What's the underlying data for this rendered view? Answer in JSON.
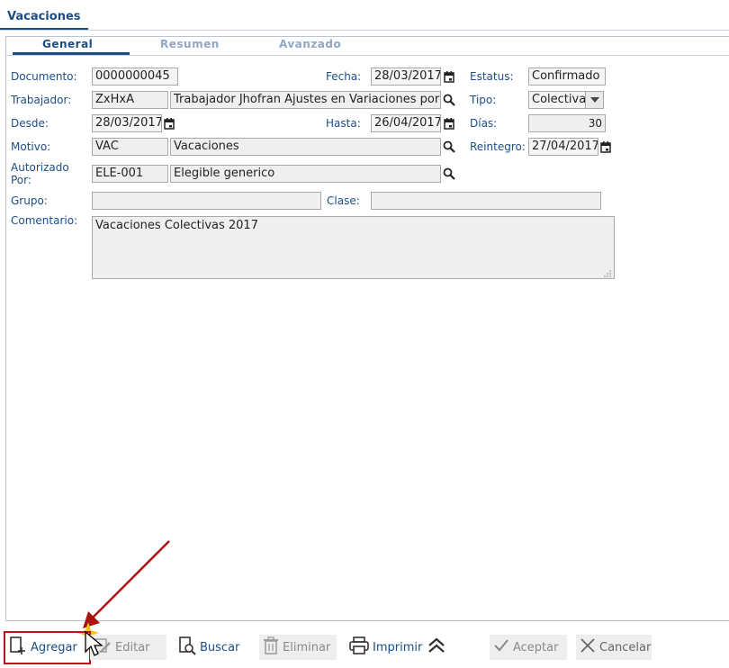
{
  "window": {
    "tab_title": "Vacaciones"
  },
  "subtabs": [
    {
      "label": "General",
      "active": true
    },
    {
      "label": "Resumen",
      "active": false
    },
    {
      "label": "Avanzado",
      "active": false
    }
  ],
  "form": {
    "documento": {
      "label": "Documento:",
      "value": "0000000045"
    },
    "fecha": {
      "label": "Fecha:",
      "value": "28/03/2017"
    },
    "estatus": {
      "label": "Estatus:",
      "value": "Confirmado"
    },
    "trabajador": {
      "label": "Trabajador:",
      "code": "ZxHxA",
      "name": "Trabajador Jhofran Ajustes en Variaciones por"
    },
    "tipo": {
      "label": "Tipo:",
      "value": "Colectiva"
    },
    "desde": {
      "label": "Desde:",
      "value": "28/03/2017"
    },
    "hasta": {
      "label": "Hasta:",
      "value": "26/04/2017"
    },
    "dias": {
      "label": "Días:",
      "value": "30"
    },
    "motivo": {
      "label": "Motivo:",
      "code": "VAC",
      "name": "Vacaciones"
    },
    "reintegro": {
      "label": "Reintegro:",
      "value": "27/04/2017"
    },
    "autorizado": {
      "label_line1": "Autorizado",
      "label_line2": "Por:",
      "code": "ELE-001",
      "name": "Elegible generico"
    },
    "grupo": {
      "label": "Grupo:",
      "value": ""
    },
    "clase": {
      "label": "Clase:",
      "value": ""
    },
    "comentario": {
      "label": "Comentario:",
      "value": "Vacaciones Colectivas 2017"
    }
  },
  "toolbar": {
    "agregar": "Agregar",
    "editar": "Editar",
    "buscar": "Buscar",
    "eliminar": "Eliminar",
    "imprimir": "Imprimir",
    "aceptar": "Aceptar",
    "cancelar": "Cancelar"
  },
  "colors": {
    "accent": "#1b4e86",
    "highlight": "#c0141c",
    "field_bg": "#efefef"
  }
}
